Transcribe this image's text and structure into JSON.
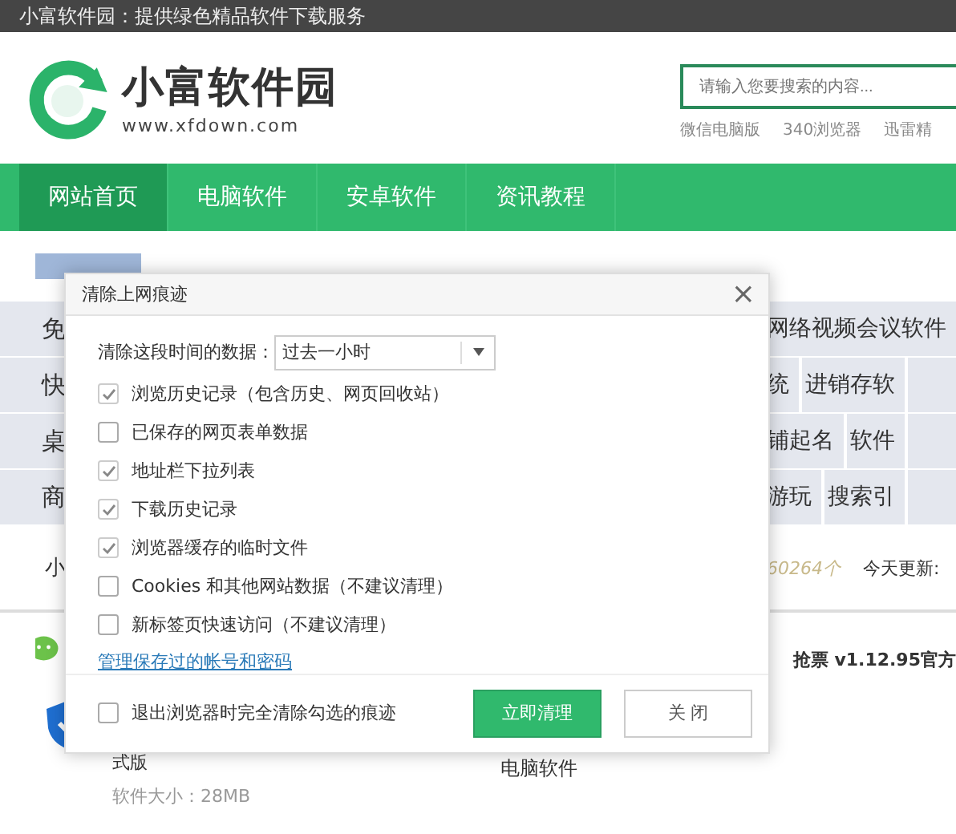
{
  "top_bar": {
    "title": "小富软件园：提供绿色精品软件下载服务"
  },
  "header": {
    "logo_name": "小富软件园",
    "logo_url": "www.xfdown.com",
    "search": {
      "placeholder": "请输入您要搜索的内容..."
    },
    "links": [
      "微信电脑版",
      "340浏览器",
      "迅雷精"
    ]
  },
  "nav": [
    {
      "label": "网站首页",
      "selected": true
    },
    {
      "label": "电脑软件",
      "selected": false
    },
    {
      "label": "安卓软件",
      "selected": false
    },
    {
      "label": "资讯教程",
      "selected": false
    }
  ],
  "page": {
    "tags_left": [
      "免",
      "快",
      "桌",
      "商"
    ],
    "tags_right": [
      [
        "网络视频会议软件"
      ],
      [
        "统",
        "进销存软"
      ],
      [
        "铺起名",
        "软件"
      ],
      [
        "游玩",
        "搜索引"
      ]
    ],
    "section_tab": "小",
    "count": "60264个",
    "today": "今天更新:",
    "featured": "抢票 v1.12.95官方",
    "app_name": "式版",
    "app_size": "软件大小：28MB",
    "category": "电脑软件"
  },
  "dialog": {
    "title": "清除上网痕迹",
    "close": "×",
    "range_label": "清除这段时间的数据：",
    "range_value": "过去一小时",
    "options": [
      {
        "label": "浏览历史记录（包含历史、网页回收站）",
        "checked": true
      },
      {
        "label": "已保存的网页表单数据",
        "checked": false
      },
      {
        "label": "地址栏下拉列表",
        "checked": true
      },
      {
        "label": "下载历史记录",
        "checked": true
      },
      {
        "label": "浏览器缓存的临时文件",
        "checked": true
      },
      {
        "label": "Cookies 和其他网站数据（不建议清理）",
        "checked": false
      },
      {
        "label": "新标签页快速访问（不建议清理）",
        "checked": false
      }
    ],
    "link": "管理保存过的帐号和密码",
    "exit_option": {
      "label": "退出浏览器时完全清除勾选的痕迹",
      "checked": false
    },
    "buttons": [
      {
        "label": "立即清理",
        "kind": "primary"
      },
      {
        "label": "关 闭",
        "kind": "secondary"
      }
    ]
  }
}
